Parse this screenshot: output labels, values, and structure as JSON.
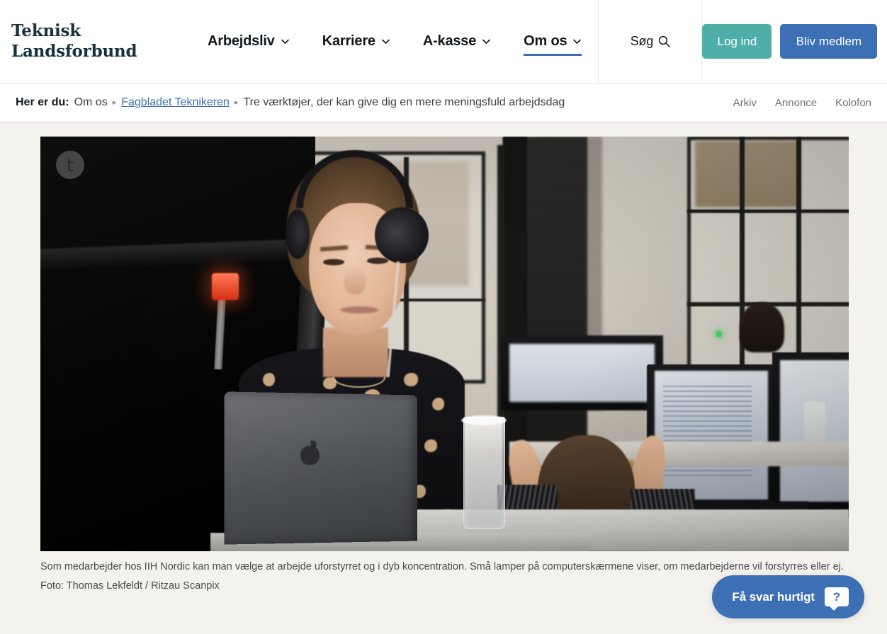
{
  "site": {
    "logo_line1": "Teknisk",
    "logo_line2": "Landsforbund",
    "accent_blue": "#3d6fb4",
    "accent_teal": "#4fafa8",
    "page_bg": "#f3f2ee"
  },
  "header": {
    "nav": [
      {
        "label": "Arbejdsliv",
        "active": false,
        "icon": "chevron-down-icon"
      },
      {
        "label": "Karriere",
        "active": false,
        "icon": "chevron-down-icon"
      },
      {
        "label": "A-kasse",
        "active": false,
        "icon": "chevron-down-icon"
      },
      {
        "label": "Om os",
        "active": true,
        "icon": "chevron-down-icon"
      }
    ],
    "search_label": "Søg",
    "search_icon": "search-icon",
    "login_label": "Log ind",
    "member_label": "Bliv medlem"
  },
  "breadcrumb": {
    "lead": "Her er du:",
    "sep": "▸",
    "items": [
      {
        "label": "Om os",
        "link": false
      },
      {
        "label": "Fagbladet Teknikeren",
        "link": true
      },
      {
        "label": "Tre værktøjer, der kan give dig en mere meningsfuld arbejdsdag",
        "link": false
      }
    ],
    "right_links": [
      {
        "label": "Arkiv"
      },
      {
        "label": "Annonce"
      },
      {
        "label": "Kolofon"
      }
    ]
  },
  "article": {
    "image_badge": "t",
    "image_badge_name": "teknikeren-logo-badge",
    "caption": "Som medarbejder hos IIH Nordic kan man vælge at arbejde uforstyrret og i dyb koncentration. Små lamper på computerskærmene viser, om medarbejderne vil forstyrres eller ej.",
    "photo_credit": "Foto: Thomas Lekfeldt / Ritzau Scanpix"
  },
  "chat": {
    "label": "Få svar hurtigt",
    "bubble_glyph": "?"
  }
}
